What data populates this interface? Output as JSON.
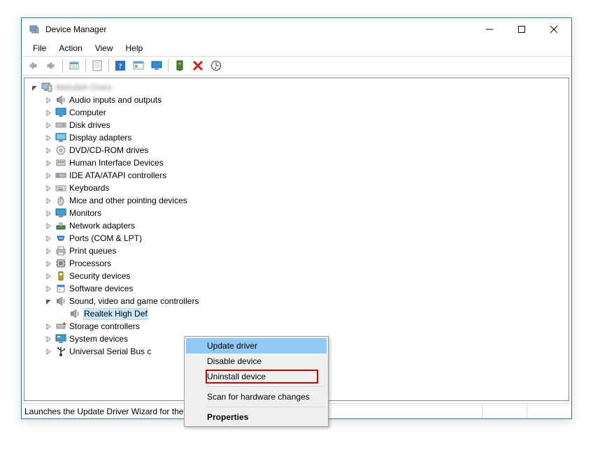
{
  "title": "Device Manager",
  "menus": [
    "File",
    "Action",
    "View",
    "Help"
  ],
  "toolbar_buttons": [
    {
      "name": "back-icon"
    },
    {
      "name": "forward-icon"
    },
    {
      "sep": true
    },
    {
      "name": "show-hidden-icon"
    },
    {
      "sep": true
    },
    {
      "name": "properties-icon"
    },
    {
      "sep": true
    },
    {
      "name": "help-icon"
    },
    {
      "name": "action-center-icon"
    },
    {
      "name": "monitor-icon"
    },
    {
      "sep": true
    },
    {
      "name": "update-driver-icon"
    },
    {
      "name": "uninstall-icon"
    },
    {
      "name": "scan-hardware-icon"
    }
  ],
  "root_label": "Abdullah  Osies",
  "categories": [
    {
      "label": "Audio inputs and outputs",
      "icon": "speaker"
    },
    {
      "label": "Computer",
      "icon": "monitor"
    },
    {
      "label": "Disk drives",
      "icon": "disk"
    },
    {
      "label": "Display adapters",
      "icon": "display"
    },
    {
      "label": "DVD/CD-ROM drives",
      "icon": "cd"
    },
    {
      "label": "Human Interface Devices",
      "icon": "hid"
    },
    {
      "label": "IDE ATA/ATAPI controllers",
      "icon": "ide"
    },
    {
      "label": "Keyboards",
      "icon": "keyboard"
    },
    {
      "label": "Mice and other pointing devices",
      "icon": "mouse"
    },
    {
      "label": "Monitors",
      "icon": "monitor"
    },
    {
      "label": "Network adapters",
      "icon": "network"
    },
    {
      "label": "Ports (COM & LPT)",
      "icon": "port"
    },
    {
      "label": "Print queues",
      "icon": "printer"
    },
    {
      "label": "Processors",
      "icon": "cpu"
    },
    {
      "label": "Security devices",
      "icon": "security"
    },
    {
      "label": "Software devices",
      "icon": "software"
    },
    {
      "label": "Sound, video and game controllers",
      "icon": "speaker",
      "expanded": true,
      "open": true
    },
    {
      "label": "Storage controllers",
      "icon": "storage"
    },
    {
      "label": "System devices",
      "icon": "system"
    },
    {
      "label": "Universal Serial Bus c",
      "icon": "usb"
    }
  ],
  "selected_device": "Realtek High Def",
  "context_menu": {
    "items": [
      {
        "label": "Update driver",
        "state": "highlight"
      },
      {
        "label": "Disable device"
      },
      {
        "label": "Uninstall device",
        "state": "boxed"
      },
      {
        "sep": true
      },
      {
        "label": "Scan for hardware changes"
      },
      {
        "sep": true
      },
      {
        "label": "Properties",
        "state": "bold"
      }
    ]
  },
  "status": "Launches the Update Driver Wizard for the selected device."
}
